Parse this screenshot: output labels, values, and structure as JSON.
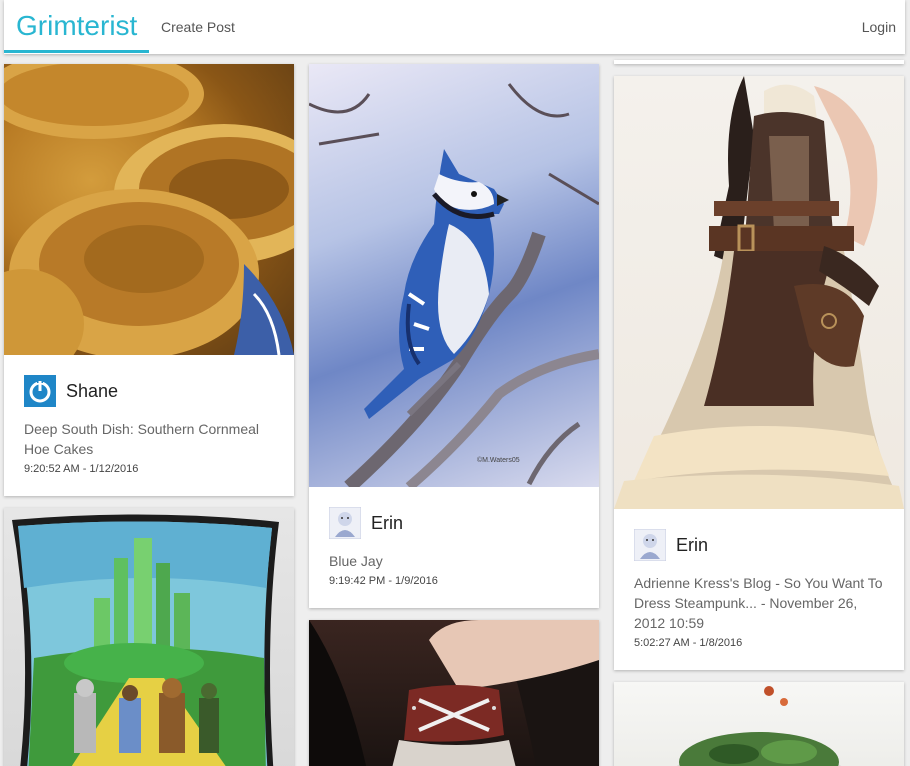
{
  "nav": {
    "brand": "Grimterist",
    "create_post": "Create Post",
    "login": "Login"
  },
  "posts": [
    {
      "author": "Shane",
      "avatar": "power-icon",
      "description": "Deep South Dish: Southern Cornmeal Hoe Cakes",
      "timestamp": "9:20:52 AM - 1/12/2016",
      "image": "pancakes-image"
    },
    {
      "author": "Erin",
      "avatar": "erin-avatar",
      "description": "Blue Jay",
      "timestamp": "9:19:42 PM - 1/9/2016",
      "image": "blue-jay-image"
    },
    {
      "author": "Erin",
      "avatar": "erin-avatar",
      "description": "Adrienne Kress's Blog - So You Want To Dress Steampunk... - November 26, 2012 10:59",
      "timestamp": "5:02:27 AM - 1/8/2016",
      "image": "steampunk-dress-image"
    },
    {
      "image": "emerald-city-pillow-image"
    },
    {
      "image": "leather-boot-image"
    },
    {
      "image": "salad-bowl-image"
    }
  ],
  "image_caption": "©M.Waters05",
  "colors": {
    "brand": "#29b6d1",
    "background": "#eeeeee",
    "card": "#ffffff"
  }
}
